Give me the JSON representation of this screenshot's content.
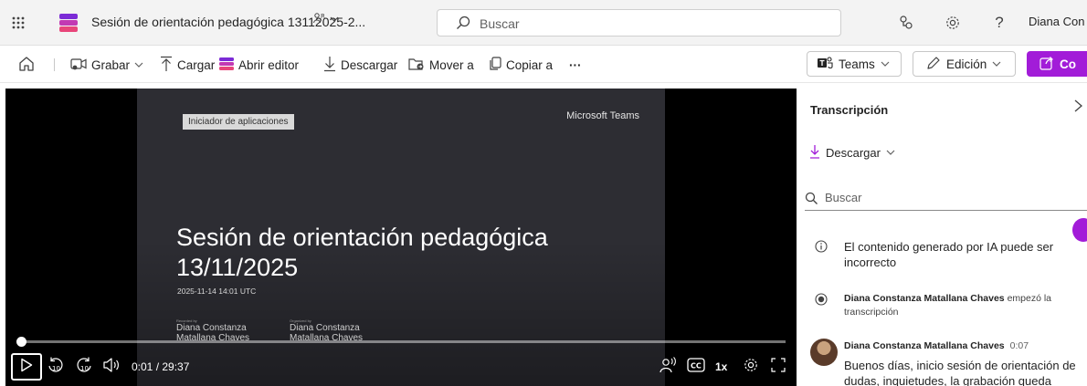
{
  "header": {
    "document_title": "Sesión de orientación pedagógica 13112025-2...",
    "search_placeholder": "Buscar",
    "user_name": "Diana Con"
  },
  "toolbar": {
    "record_label": "Grabar",
    "upload_label": "Cargar",
    "open_editor_label": "Abrir editor",
    "download_label": "Descargar",
    "move_label": "Mover a",
    "copy_label": "Copiar a",
    "more_label": "···",
    "teams_label": "Teams",
    "edit_label": "Edición",
    "primary_label": "Co"
  },
  "video": {
    "slide_chip": "Iniciador de aplicaciones",
    "slide_brand": "Microsoft Teams",
    "slide_title": "Sesión de orientación pedagógica 13/11/2025",
    "slide_datetime": "2025-11-14 14:01 UTC",
    "recorded_by_label": "Recorded by",
    "recorded_by_name": "Diana Constanza Matallana Chaves",
    "organized_by_label": "Organized by",
    "organized_by_name": "Diana Constanza Matallana Chaves",
    "time_display": "0:01 / 29:37",
    "playback_rate": "1x",
    "progress_fraction": 0.0006
  },
  "transcript": {
    "title": "Transcripción",
    "download_label": "Descargar",
    "search_placeholder": "Buscar",
    "ai_notice": "El contenido generado por IA puede ser incorrecto",
    "start_speaker": "Diana Constanza Matallana Chaves",
    "start_text": "empezó la transcripción",
    "entry_speaker": "Diana Constanza Matallana Chaves",
    "entry_time": "0:07",
    "entry_text": "Buenos días, inicio sesión de orientación de dudas, inquietudes, la grabación queda"
  },
  "colors": {
    "accent": "#a21cd8",
    "topbar_bg": "#f3f3f3",
    "slide_bg": "#2d2d33"
  },
  "icons": [
    "waffle-icon",
    "app-logo-icon",
    "share-people-icon",
    "chevron-down-icon",
    "search-icon",
    "people-icon",
    "gear-icon",
    "help-icon",
    "home-icon",
    "record-icon",
    "upload-icon",
    "editor-icon",
    "download-icon",
    "move-icon",
    "copy-icon",
    "teams-icon",
    "pencil-icon",
    "share-icon",
    "play-icon",
    "rewind-10-icon",
    "forward-10-icon",
    "volume-icon",
    "speaker-icon",
    "captions-icon",
    "settings-icon",
    "fullscreen-icon",
    "close-icon",
    "info-icon",
    "radio-icon"
  ]
}
